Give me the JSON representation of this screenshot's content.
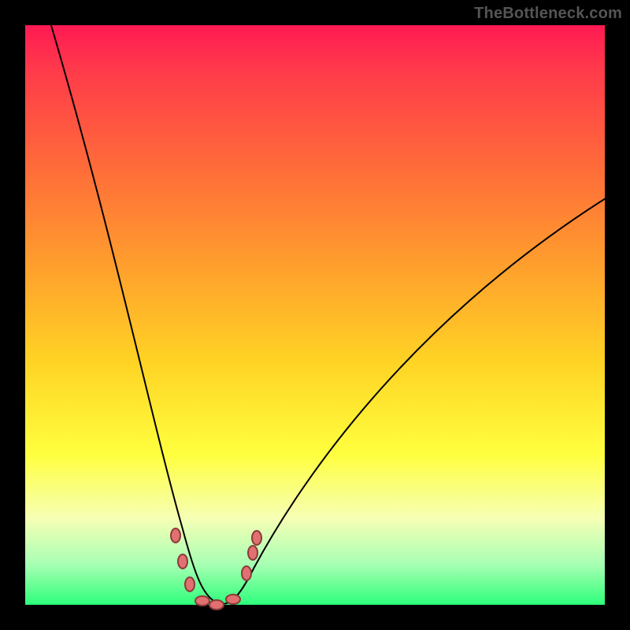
{
  "watermark": "TheBottleneck.com",
  "chart_data": {
    "type": "line",
    "title": "",
    "xlabel": "",
    "ylabel": "",
    "xlim": [
      0,
      1
    ],
    "ylim": [
      0,
      1
    ],
    "series": [
      {
        "name": "curve",
        "x": [
          0.04,
          0.3,
          0.33,
          0.4,
          1.0
        ],
        "values": [
          1.0,
          0.05,
          0.0,
          0.05,
          0.7
        ]
      }
    ],
    "points": [
      {
        "name": "p1",
        "x": 0.26,
        "y": 0.12
      },
      {
        "name": "p2",
        "x": 0.272,
        "y": 0.075
      },
      {
        "name": "p3",
        "x": 0.284,
        "y": 0.035
      },
      {
        "name": "p4",
        "x": 0.305,
        "y": 0.007
      },
      {
        "name": "p5",
        "x": 0.33,
        "y": 0.0
      },
      {
        "name": "p6",
        "x": 0.358,
        "y": 0.01
      },
      {
        "name": "p7",
        "x": 0.382,
        "y": 0.055
      },
      {
        "name": "p8",
        "x": 0.392,
        "y": 0.09
      },
      {
        "name": "p9",
        "x": 0.4,
        "y": 0.115
      }
    ]
  }
}
